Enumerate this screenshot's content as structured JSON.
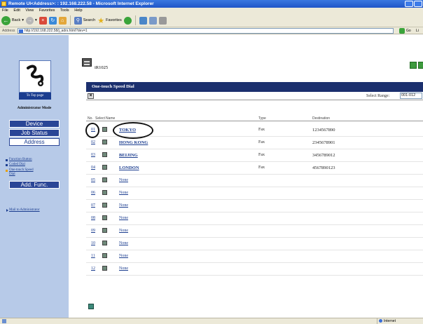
{
  "window": {
    "title": "Remote UI<Address>: : 192.168.222.58 - Microsoft Internet Explorer"
  },
  "menu": [
    "File",
    "Edit",
    "View",
    "Favorites",
    "Tools",
    "Help"
  ],
  "toolbar": {
    "back_label": "Back",
    "search_label": "Search",
    "favorites_label": "Favorites"
  },
  "addressbar": {
    "label": "Address",
    "url": "http://192.168.222.58/j_adrs.html?dev=1",
    "go_label": "Go",
    "links_label": "Li"
  },
  "sidebar": {
    "top_page_label": "To Top page",
    "mode_label": "Administrator Mode",
    "nav": [
      {
        "label": "Device"
      },
      {
        "label": "Job Status"
      },
      {
        "label": "Address"
      }
    ],
    "sub_items": [
      {
        "label": "Function Button"
      },
      {
        "label": "Coded Dial"
      },
      {
        "label": "One-touch Speed Dial"
      }
    ],
    "add_func_label": "Add. Func.",
    "mail_label": "Mail to Administrator"
  },
  "main": {
    "device_name": "iR1025",
    "panel_title": "One-touch Speed Dial",
    "range_label": "Select Range:",
    "range_value": "001-012",
    "columns": {
      "no": "No.",
      "select": "Select",
      "name": "Name",
      "type": "Type",
      "destination": "Destination"
    },
    "rows": [
      {
        "no": "01",
        "name": "TOKYO",
        "type": "Fax",
        "destination": "1234567890"
      },
      {
        "no": "02",
        "name": "HONG KONG",
        "type": "Fax",
        "destination": "2345678901"
      },
      {
        "no": "03",
        "name": "BEIJING",
        "type": "Fax",
        "destination": "3456789012"
      },
      {
        "no": "04",
        "name": "LONDON",
        "type": "Fax",
        "destination": "4567890123"
      },
      {
        "no": "05",
        "name": "None",
        "type": "",
        "destination": ""
      },
      {
        "no": "06",
        "name": "None",
        "type": "",
        "destination": ""
      },
      {
        "no": "07",
        "name": "None",
        "type": "",
        "destination": ""
      },
      {
        "no": "08",
        "name": "None",
        "type": "",
        "destination": ""
      },
      {
        "no": "09",
        "name": "None",
        "type": "",
        "destination": ""
      },
      {
        "no": "10",
        "name": "None",
        "type": "",
        "destination": ""
      },
      {
        "no": "11",
        "name": "None",
        "type": "",
        "destination": ""
      },
      {
        "no": "12",
        "name": "None",
        "type": "",
        "destination": ""
      }
    ]
  },
  "statusbar": {
    "zone_label": "Internet"
  }
}
